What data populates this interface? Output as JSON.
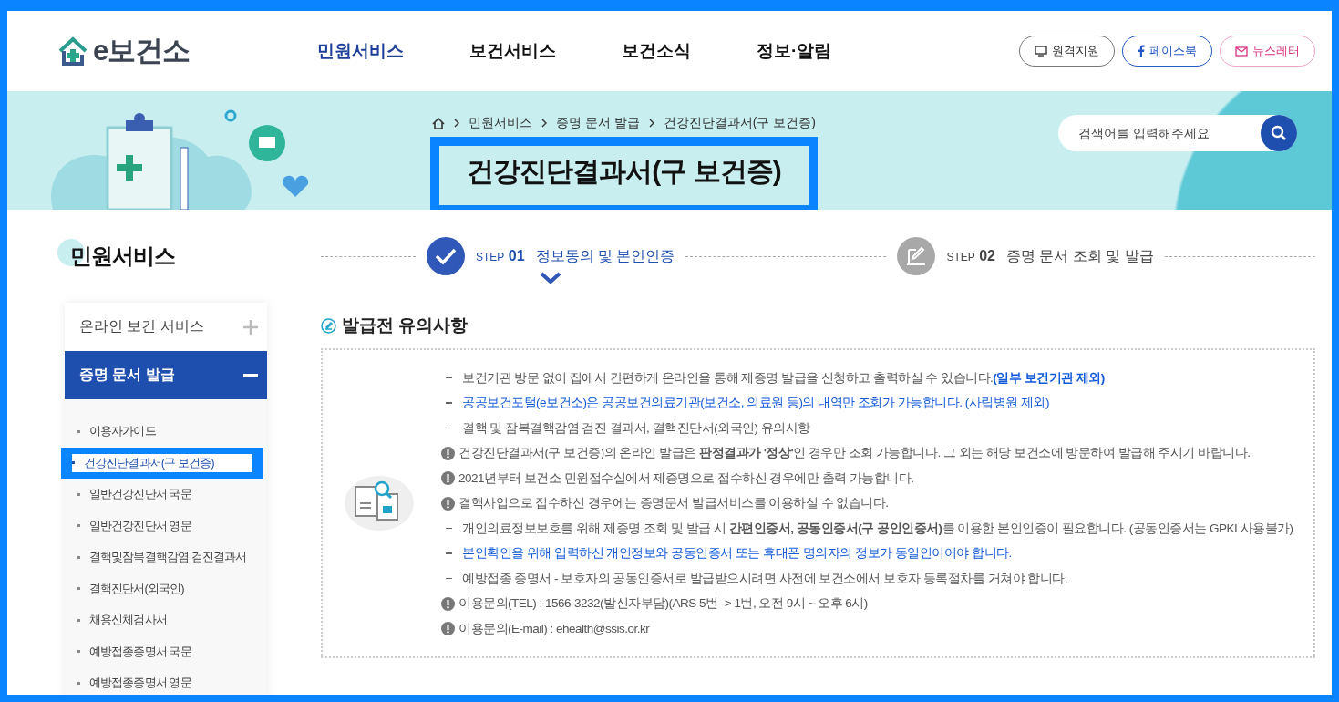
{
  "header": {
    "logo": "e보건소",
    "nav": [
      {
        "label": "민원서비스",
        "selected": true
      },
      {
        "label": "보건서비스",
        "selected": false
      },
      {
        "label": "보건소식",
        "selected": false
      },
      {
        "label": "정보·알림",
        "selected": false
      }
    ],
    "buttons": [
      {
        "label": "원격지원",
        "kind": "remote"
      },
      {
        "label": "페이스북",
        "kind": "facebook"
      },
      {
        "label": "뉴스레터",
        "kind": "newsletter"
      }
    ]
  },
  "banner": {
    "breadcrumb": [
      "민원서비스",
      "증명 문서 발급",
      "건강진단결과서(구 보건증)"
    ],
    "title": "건강진단결과서(구 보건증)",
    "search": {
      "placeholder": "검색어를 입력해주세요"
    }
  },
  "sidebar": {
    "title": "민원서비스",
    "items": [
      {
        "label": "온라인 보건 서비스",
        "expanded": false
      },
      {
        "label": "증명 문서 발급",
        "expanded": true,
        "children": [
          {
            "label": "이용자가이드",
            "selected": false
          },
          {
            "label": "건강진단결과서(구 보건증)",
            "selected": true
          },
          {
            "label": "일반건강진단서 국문",
            "selected": false
          },
          {
            "label": "일반건강진단서 영문",
            "selected": false
          },
          {
            "label": "결핵및잠복결핵감염 검진결과서",
            "selected": false
          },
          {
            "label": "결핵진단서(외국인)",
            "selected": false
          },
          {
            "label": "채용신체검사서",
            "selected": false
          },
          {
            "label": "예방접종증명서 국문",
            "selected": false
          },
          {
            "label": "예방접종증명서 영문",
            "selected": false
          }
        ]
      }
    ]
  },
  "steps": [
    {
      "label": "STEP",
      "number": "01",
      "title": "정보동의 및 본인인증",
      "selected": true
    },
    {
      "label": "STEP",
      "number": "02",
      "title": "증명 문서 조회 및 발급",
      "selected": false
    }
  ],
  "notice": {
    "title": "발급전 유의사항",
    "items": [
      {
        "kind": "dash",
        "emphasis": false,
        "text": "보건기관 방문 없이 집에서 간편하게 온라인을 통해 제증명 발급을 신청하고 출력하실 수 있습니다.",
        "note": "(일부 보건기관 제외)"
      },
      {
        "kind": "dash",
        "emphasis": true,
        "text": "공공보건포털(e보건소)은 공공보건의료기관(보건소, 의료원 등)의 내역만 조회가 가능합니다. (사립병원 제외)"
      },
      {
        "kind": "dash",
        "emphasis": false,
        "text": "결핵 및 잠복결핵감염 검진 결과서, 결핵진단서(외국인) 유의사항"
      },
      {
        "kind": "alert",
        "emphasis": false,
        "text": "건강진단결과서(구 보건증)의 온라인 발급은 **판정결과가 '정상'**인 경우만 조회 가능합니다. 그 외는 해당 보건소에 방문하여 발급해 주시기 바랍니다."
      },
      {
        "kind": "alert",
        "emphasis": false,
        "text": "2021년부터 보건소 민원접수실에서 제증명으로 접수하신 경우에만 출력 가능합니다."
      },
      {
        "kind": "alert",
        "emphasis": false,
        "text": "결핵사업으로 접수하신 경우에는 증명문서 발급서비스를 이용하실 수 없습니다."
      },
      {
        "kind": "dash",
        "emphasis": false,
        "text": "개인의료정보보호를 위해 제증명 조회 및 발급 시 **간편인증서, 공동인증서(구 공인인증서)**를 이용한 본인인증이 필요합니다. (공동인증서는 GPKI 사용불가)"
      },
      {
        "kind": "dash",
        "emphasis": true,
        "text": "본인확인을 위해 입력하신 개인정보와 공동인증서 또는 휴대폰 명의자의 정보가 동일인이어야 합니다."
      },
      {
        "kind": "dash",
        "emphasis": false,
        "text": "예방접종 증명서 - 보호자의 공동인증서로 발급받으시려면 사전에 보건소에서 보호자 등록절차를 거쳐야 합니다."
      },
      {
        "kind": "alert",
        "emphasis": false,
        "text": "이용문의(TEL) : 1566-3232(발신자부담)(ARS 5번 -> 1번, 오전 9시 ~ 오후 6시)"
      },
      {
        "kind": "alert",
        "emphasis": false,
        "text": "이용문의(E-mail) : ehealth@ssis.or.kr"
      }
    ]
  }
}
